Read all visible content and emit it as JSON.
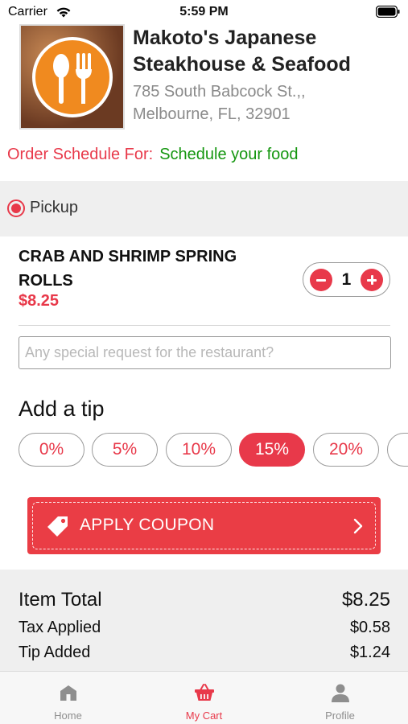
{
  "status_bar": {
    "carrier": "Carrier",
    "time": "5:59 PM"
  },
  "restaurant": {
    "name": "Makoto's Japanese Steakhouse & Seafood",
    "address_line1": "785 South Babcock St.,,",
    "address_line2": "Melbourne, FL, 32901"
  },
  "schedule": {
    "label": "Order Schedule For:",
    "value": "Schedule your food"
  },
  "pickup": {
    "label": "Pickup",
    "selected": true
  },
  "cart_item": {
    "name": "CRAB AND SHRIMP SPRING ROLLS",
    "price": "$8.25",
    "quantity": "1"
  },
  "special_request": {
    "placeholder": "Any special request for the restaurant?",
    "value": ""
  },
  "tips": {
    "title": "Add a tip",
    "options": [
      "0%",
      "5%",
      "10%",
      "15%",
      "20%",
      ""
    ],
    "selected": "15%"
  },
  "coupon": {
    "label": "APPLY COUPON"
  },
  "totals": {
    "item_total_label": "Item Total",
    "item_total_value": "$8.25",
    "tax_label": "Tax Applied",
    "tax_value": "$0.58",
    "tip_label": "Tip Added",
    "tip_value": "$1.24"
  },
  "nav": {
    "home": "Home",
    "cart": "My Cart",
    "profile": "Profile"
  },
  "colors": {
    "accent": "#e8394a",
    "schedule_green": "#14960f",
    "logo_orange": "#f08a1f",
    "panel_gray": "#efefef"
  },
  "icons": [
    "wifi-icon",
    "battery-icon",
    "spoon-fork-logo-icon",
    "coupon-tag-icon",
    "chevron-right-icon",
    "home-icon",
    "basket-icon",
    "person-icon"
  ]
}
